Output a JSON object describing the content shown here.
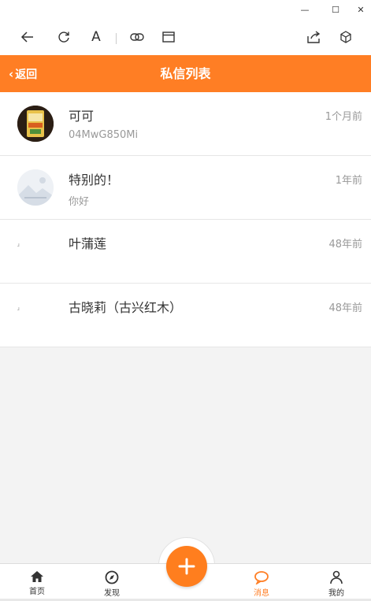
{
  "window": {
    "minimize_glyph": "—",
    "maximize_glyph": "☐",
    "close_glyph": "✕"
  },
  "toolbar": {
    "font_glyph": "A",
    "icons": [
      "back-arrow-icon",
      "refresh-icon",
      "font-size-icon",
      "link-icon",
      "window-icon",
      "share-icon",
      "cube-icon"
    ]
  },
  "header": {
    "back_chevron": "‹",
    "back_label": "返回",
    "title": "私信列表",
    "color": "#ff7e24"
  },
  "messages": [
    {
      "name": "可可",
      "preview": "04MwG850Mi",
      "time": "1个月前",
      "avatar": "product-photo"
    },
    {
      "name": "特别的！",
      "preview": "你好",
      "time": "1年前",
      "avatar": "placeholder-landscape"
    },
    {
      "name": "叶蒲莲",
      "preview": "",
      "time": "48年前",
      "avatar": "broken-image"
    },
    {
      "name": "古晓莉（古兴红木）",
      "preview": "",
      "time": "48年前",
      "avatar": "broken-image"
    }
  ],
  "avatar_placeholder_glyph": "ɹ",
  "tabbar": {
    "tabs": [
      {
        "label": "首页",
        "icon": "home-icon"
      },
      {
        "label": "发现",
        "icon": "compass-icon"
      },
      {
        "label": "消息",
        "icon": "chat-bubble-icon",
        "active": true
      },
      {
        "label": "我的",
        "icon": "profile-icon"
      }
    ],
    "fab_glyph": "+",
    "active_color": "#ff7e24"
  }
}
